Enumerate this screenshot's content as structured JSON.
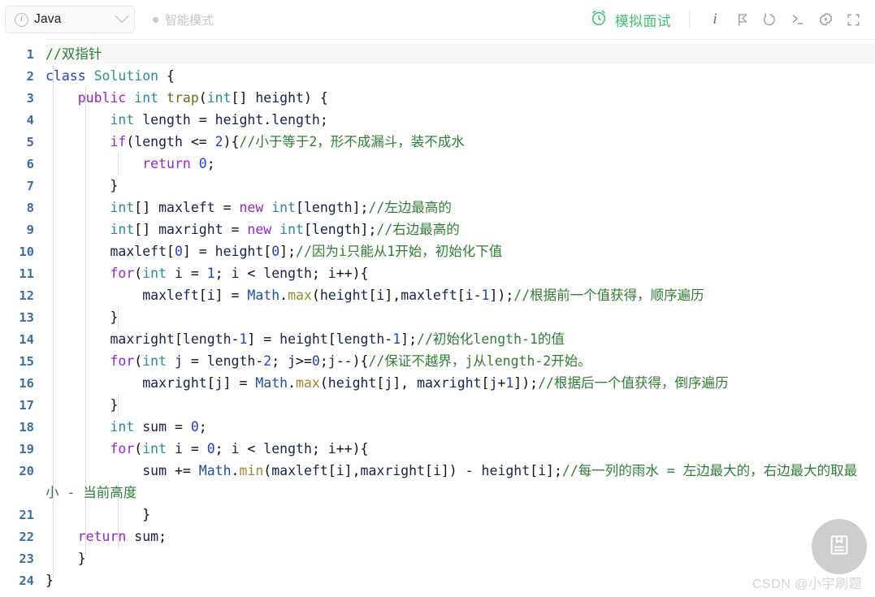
{
  "topbar": {
    "language": "Java",
    "info_icon": "info-circle-icon",
    "dropdown_icon": "chevron-down-icon",
    "smart_mode": "智能模式",
    "status_dot": "status-dot",
    "mock_interview": "模拟面试",
    "clock_icon": "alarm-clock-icon",
    "accent_green": "#3cc46d",
    "icons": [
      {
        "name": "info-italic-icon",
        "glyph": "i"
      },
      {
        "name": "flag-icon",
        "glyph": "flag"
      },
      {
        "name": "reset-undo-icon",
        "glyph": "undo"
      },
      {
        "name": "console-terminal-icon",
        "glyph": "terminal"
      },
      {
        "name": "settings-gear-icon",
        "glyph": "gear"
      },
      {
        "name": "fullscreen-icon",
        "glyph": "fullscreen"
      }
    ]
  },
  "editor": {
    "language": "java",
    "line_numbers": [
      "1",
      "2",
      "3",
      "4",
      "5",
      "6",
      "7",
      "8",
      "9",
      "10",
      "11",
      "12",
      "13",
      "14",
      "15",
      "16",
      "17",
      "18",
      "19",
      "20",
      "21",
      "22",
      "23",
      "24"
    ],
    "lines": [
      {
        "n": "1",
        "text": "//双指针"
      },
      {
        "n": "2",
        "text": "class Solution {"
      },
      {
        "n": "3",
        "text": "    public int trap(int[] height) {"
      },
      {
        "n": "4",
        "text": "        int length = height.length;"
      },
      {
        "n": "5",
        "text": "        if(length <= 2){//小于等于2，形不成漏斗，装不成水"
      },
      {
        "n": "6",
        "text": "            return 0;"
      },
      {
        "n": "7",
        "text": "        }"
      },
      {
        "n": "8",
        "text": "        int[] maxleft = new int[length];//左边最高的"
      },
      {
        "n": "9",
        "text": "        int[] maxright = new int[length];//右边最高的"
      },
      {
        "n": "10",
        "text": "        maxleft[0] = height[0];//因为i只能从1开始，初始化下值"
      },
      {
        "n": "11",
        "text": "        for(int i = 1; i < length; i++){"
      },
      {
        "n": "12",
        "text": "            maxleft[i] = Math.max(height[i],maxleft[i-1]);//根据前一个值获得，顺序遍历"
      },
      {
        "n": "13",
        "text": "        }"
      },
      {
        "n": "14",
        "text": "        maxright[length-1] = height[length-1];//初始化length-1的值"
      },
      {
        "n": "15",
        "text": "        for(int j = length-2; j>=0;j--){//保证不越界，j从length-2开始。"
      },
      {
        "n": "16",
        "text": "            maxright[j] = Math.max(height[j], maxright[j+1]);//根据后一个值获得，倒序遍历"
      },
      {
        "n": "17",
        "text": "        }"
      },
      {
        "n": "18",
        "text": "        int sum = 0;"
      },
      {
        "n": "19",
        "text": "        for(int i = 0; i < length; i++){"
      },
      {
        "n": "20",
        "text": "            sum += Math.min(maxleft[i],maxright[i]) - height[i];//每一列的雨水 = 左边最大的，右边最大的取最小 - 当前高度"
      },
      {
        "n": "21",
        "text": "        }"
      },
      {
        "n": "22",
        "text": "    return sum;"
      },
      {
        "n": "23",
        "text": "    }"
      },
      {
        "n": "24",
        "text": "}"
      }
    ]
  },
  "overlay": {
    "fab_icon": "book-notes-icon",
    "watermark": "CSDN @小宇刷题"
  }
}
